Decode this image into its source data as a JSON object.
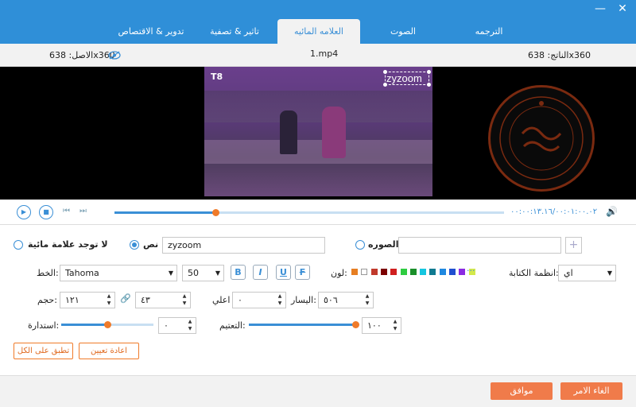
{
  "tabs": [
    {
      "label": "الترجمه"
    },
    {
      "label": "الصوت"
    },
    {
      "label": "العلامه المائيه"
    },
    {
      "label": "تاثير & تصفية"
    },
    {
      "label": "تدوير & الاقتصاص"
    }
  ],
  "info": {
    "output": "الناتج: 638x360",
    "filename": "1.mp4",
    "original": "الاصل: 638x360"
  },
  "video": {
    "watermark_text": "zyzoom",
    "channel_logo": "T8"
  },
  "playback": {
    "time": "٠٠:٠٠:١٣.١٦/٠٠:٠١:٠٠.٠٢",
    "progress": 0.26
  },
  "watermark": {
    "none_label": "لا توجد علامة مائية",
    "text_label": "نص",
    "text_value": "zyzoom",
    "image_label": "الصوره",
    "image_value": "",
    "add_symbol": "+"
  },
  "font": {
    "font_label": "الخط:",
    "font_value": "Tahoma",
    "size_value": "50",
    "bold": "B",
    "italic": "I",
    "underline": "U",
    "strike": "F",
    "color_label": "لون:",
    "more": "···",
    "system_label": "انظمة الكتابة:",
    "system_value": "اي"
  },
  "colors": [
    "#e67e22",
    "#ffffff",
    "#c0392b",
    "#7b0000",
    "#d01f1f",
    "#2ecc40",
    "#1a8f2a",
    "#14c6e0",
    "#0f7a90",
    "#1f88e0",
    "#1f4fd0",
    "#8a2be2",
    "#d4e94a"
  ],
  "position": {
    "size_label": "حجم:",
    "width": "١٢١",
    "height": "٤٣",
    "top_label": "اعلي",
    "top": "٠",
    "left_label": "اليسار:",
    "left": "٥٠٦"
  },
  "adjust": {
    "rotate_label": "استدارة:",
    "rotate": "٠",
    "rotate_level": 0.5,
    "opacity_label": "التعتيم:",
    "opacity": "١٠٠",
    "opacity_level": 1.0
  },
  "actions": {
    "reset": "اعادة تعيين",
    "apply_all": "تطبق على الكل"
  },
  "footer": {
    "ok": "موافق",
    "cancel": "الغاء الامر"
  }
}
